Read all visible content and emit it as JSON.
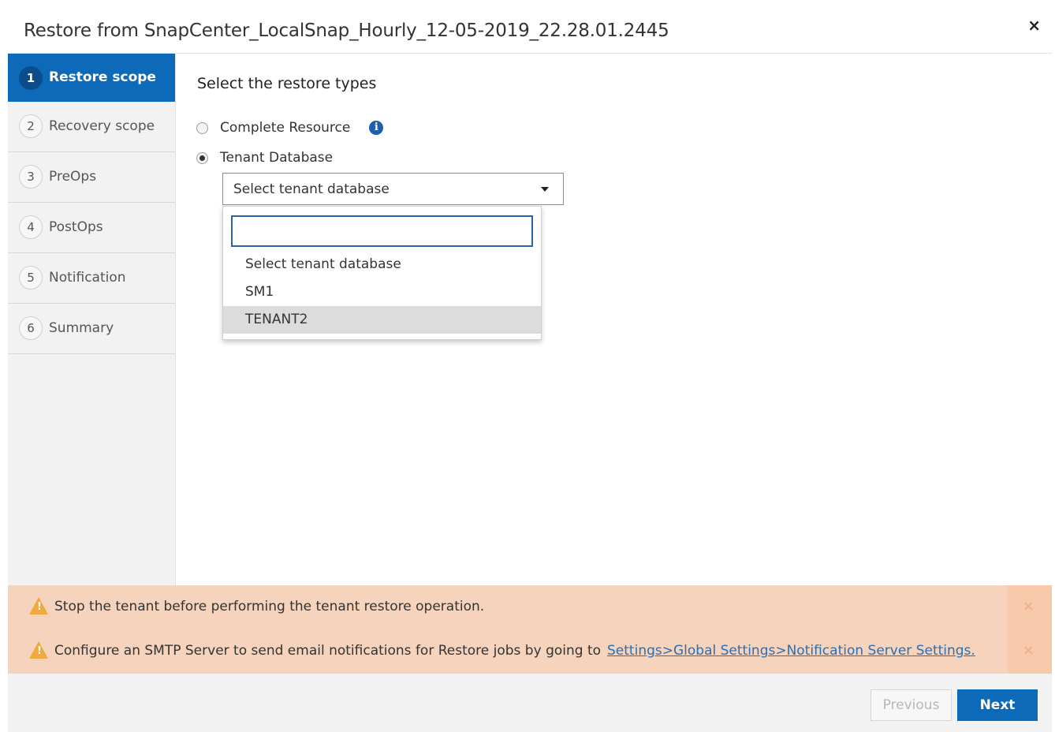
{
  "dialog": {
    "title": "Restore from SnapCenter_LocalSnap_Hourly_12-05-2019_22.28.01.2445",
    "close_symbol": "×"
  },
  "steps": [
    {
      "num": "1",
      "label": "Restore scope",
      "active": true
    },
    {
      "num": "2",
      "label": "Recovery scope",
      "active": false
    },
    {
      "num": "3",
      "label": "PreOps",
      "active": false
    },
    {
      "num": "4",
      "label": "PostOps",
      "active": false
    },
    {
      "num": "5",
      "label": "Notification",
      "active": false
    },
    {
      "num": "6",
      "label": "Summary",
      "active": false
    }
  ],
  "content": {
    "section_title": "Select the restore types",
    "radio_options": [
      {
        "label": "Complete Resource",
        "checked": false,
        "has_info_icon": true
      },
      {
        "label": "Tenant Database",
        "checked": true
      }
    ],
    "info_icon_glyph": "i",
    "tenant_select": {
      "value": "Select tenant database",
      "search_value": "",
      "search_placeholder": "",
      "options": [
        "Select tenant database",
        "SM1",
        "TENANT2"
      ],
      "highlighted": "TENANT2"
    }
  },
  "alerts": [
    {
      "text": "Stop the tenant before performing the tenant restore operation.",
      "link": ""
    },
    {
      "text": "Configure an SMTP Server to send email notifications for Restore jobs by going to",
      "link": "Settings>Global Settings>Notification Server Settings."
    }
  ],
  "alert_close_symbol": "×",
  "footer": {
    "previous_label": "Previous",
    "next_label": "Next"
  },
  "colors": {
    "accent": "#0d6ab8",
    "alert_bg": "#f5d3bc",
    "warning": "#f0a93b",
    "link": "#2a6fb3"
  }
}
